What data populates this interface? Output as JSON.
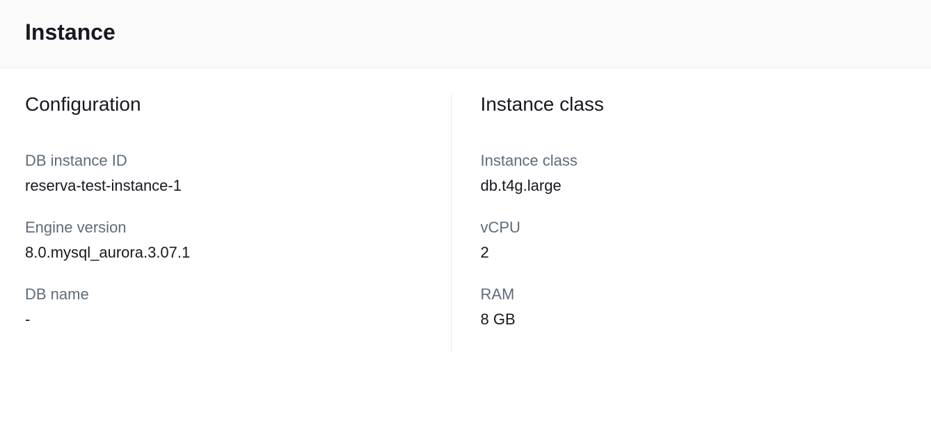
{
  "header": {
    "title": "Instance"
  },
  "configuration": {
    "title": "Configuration",
    "db_instance_id": {
      "label": "DB instance ID",
      "value": "reserva-test-instance-1"
    },
    "engine_version": {
      "label": "Engine version",
      "value": "8.0.mysql_aurora.3.07.1"
    },
    "db_name": {
      "label": "DB name",
      "value": "-"
    }
  },
  "instance_class": {
    "title": "Instance class",
    "class": {
      "label": "Instance class",
      "value": "db.t4g.large"
    },
    "vcpu": {
      "label": "vCPU",
      "value": "2"
    },
    "ram": {
      "label": "RAM",
      "value": "8 GB"
    }
  }
}
